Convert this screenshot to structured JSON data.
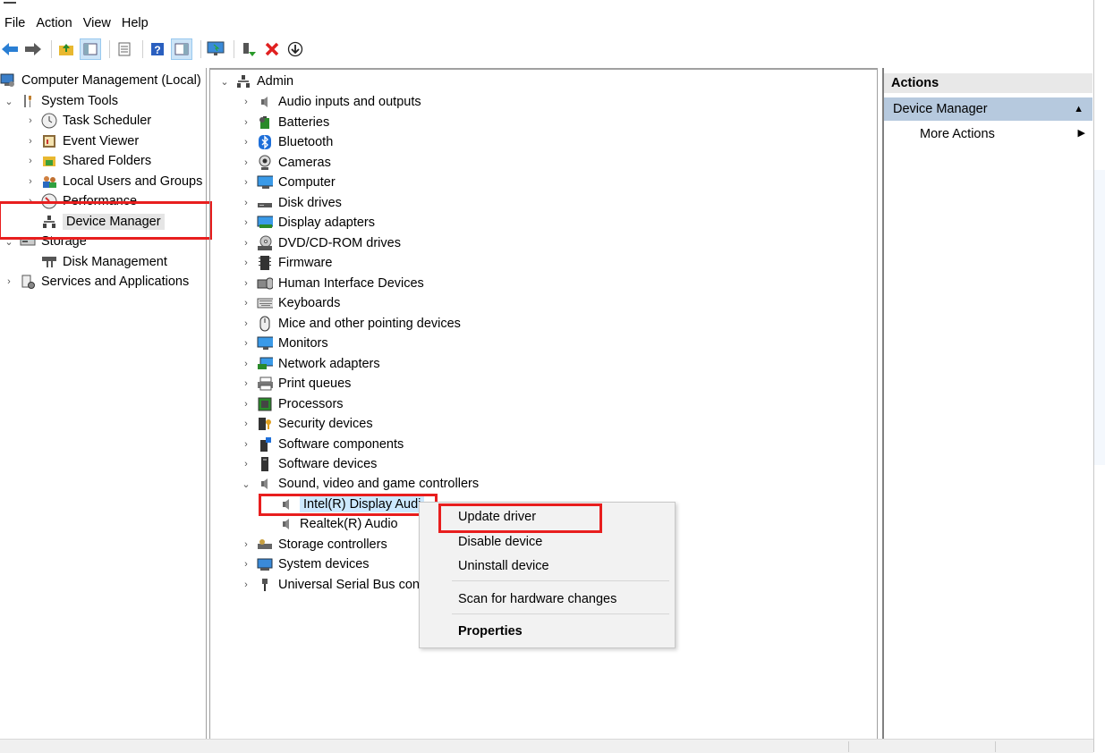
{
  "menu": [
    "File",
    "Action",
    "View",
    "Help"
  ],
  "toolbar_icons": [
    "back-arrow-icon",
    "forward-arrow-icon",
    "up-folder-icon",
    "show-hide-console-tree-icon",
    "properties-icon",
    "help-icon",
    "show-hide-action-pane-icon",
    "monitor-icon",
    "enable-device-icon",
    "uninstall-icon",
    "download-driver-icon"
  ],
  "left_tree": {
    "root": "Computer Management (Local)",
    "system_tools": "System Tools",
    "task_scheduler": "Task Scheduler",
    "event_viewer": "Event Viewer",
    "shared_folders": "Shared Folders",
    "local_users": "Local Users and Groups",
    "performance": "Performance",
    "device_manager": "Device Manager",
    "storage": "Storage",
    "disk_management": "Disk Management",
    "services": "Services and Applications"
  },
  "device_tree": {
    "root": "Admin",
    "categories": [
      "Audio inputs and outputs",
      "Batteries",
      "Bluetooth",
      "Cameras",
      "Computer",
      "Disk drives",
      "Display adapters",
      "DVD/CD-ROM drives",
      "Firmware",
      "Human Interface Devices",
      "Keyboards",
      "Mice and other pointing devices",
      "Monitors",
      "Network adapters",
      "Print queues",
      "Processors",
      "Security devices",
      "Software components",
      "Software devices",
      "Sound, video and game controllers"
    ],
    "sound_children": [
      "Intel(R) Display Audi",
      "Realtek(R) Audio"
    ],
    "after": [
      "Storage controllers",
      "System devices",
      "Universal Serial Bus con"
    ]
  },
  "actions": {
    "header": "Actions",
    "section": "Device Manager",
    "more": "More Actions"
  },
  "context_menu": {
    "update": "Update driver",
    "disable": "Disable device",
    "uninstall": "Uninstall device",
    "scan": "Scan for hardware changes",
    "properties": "Properties"
  },
  "colors": {
    "highlight": "#e81e1e",
    "actions_section": "#b6c9de"
  }
}
